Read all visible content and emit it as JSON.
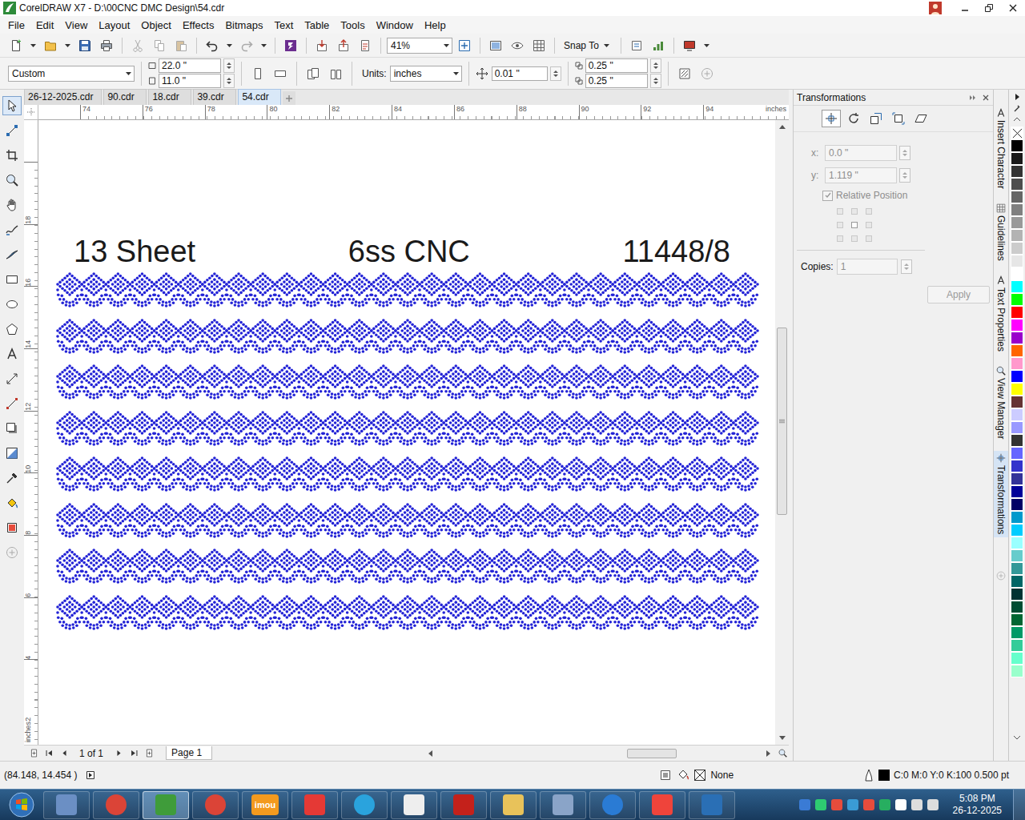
{
  "window": {
    "title": "CorelDRAW X7 - D:\\00CNC DMC Design\\54.cdr"
  },
  "menu": [
    "File",
    "Edit",
    "View",
    "Layout",
    "Object",
    "Effects",
    "Bitmaps",
    "Text",
    "Table",
    "Tools",
    "Window",
    "Help"
  ],
  "toolbar": {
    "zoom": "41%",
    "snap": "Snap To"
  },
  "property_bar": {
    "page_size": "Custom",
    "width": "22.0 \"",
    "height": "11.0 \"",
    "units_label": "Units:",
    "units": "inches",
    "nudge": "0.01 \"",
    "dup_x": "0.25 \"",
    "dup_y": "0.25 \""
  },
  "doc_tabs": [
    {
      "label": "26-12-2025.cdr",
      "selected": false
    },
    {
      "label": "90.cdr",
      "selected": false
    },
    {
      "label": "18.cdr",
      "selected": false
    },
    {
      "label": "39.cdr",
      "selected": false
    },
    {
      "label": "54.cdr",
      "selected": true
    }
  ],
  "ruler": {
    "h_ticks": [
      "74",
      "76",
      "78",
      "80",
      "82",
      "84",
      "86",
      "88",
      "90",
      "92",
      "94"
    ],
    "h_unit": "inches",
    "v_ticks": [
      "18",
      "16",
      "14",
      "12",
      "10",
      "8",
      "6",
      "4",
      "2"
    ],
    "v_unit": "inches"
  },
  "toolbox": [
    {
      "selected": true
    },
    {
      "selected": false
    },
    {
      "selected": false
    },
    {
      "selected": false
    },
    {
      "selected": false
    },
    {
      "selected": false
    },
    {
      "selected": false
    },
    {
      "selected": false
    },
    {
      "selected": false
    },
    {
      "selected": false
    },
    {
      "selected": false
    },
    {
      "selected": false
    },
    {
      "selected": false
    },
    {
      "selected": false
    },
    {
      "selected": false
    },
    {
      "selected": false
    },
    {
      "selected": false
    },
    {
      "selected": false
    },
    {
      "selected": false
    }
  ],
  "canvas": {
    "texts": [
      "13 Sheet",
      "6ss CNC",
      "11448/8"
    ],
    "rows": [
      {
        "motifs": 29
      },
      {
        "motifs": 29
      },
      {
        "motifs": 29
      },
      {
        "motifs": 29
      },
      {
        "motifs": 29
      },
      {
        "motifs": 29
      },
      {
        "motifs": 29
      },
      {
        "motifs": 29
      }
    ]
  },
  "page_nav": {
    "counter": "1 of 1",
    "page_tab": "Page 1"
  },
  "docker": {
    "title": "Transformations",
    "tools": [
      {
        "selected": true
      },
      {
        "selected": false
      },
      {
        "selected": false
      },
      {
        "selected": false
      },
      {
        "selected": false
      }
    ],
    "fields": [
      {
        "label": "x:",
        "value": "0.0 \"",
        "disabled": true
      },
      {
        "label": "y:",
        "value": "1.119 \"",
        "disabled": true
      }
    ],
    "relative": {
      "label": "Relative Position",
      "checked": true,
      "disabled": true
    },
    "anchors": [
      {
        "selected": false
      },
      {
        "selected": false
      },
      {
        "selected": false
      },
      {
        "selected": false
      },
      {
        "selected": true
      },
      {
        "selected": false
      },
      {
        "selected": false
      },
      {
        "selected": false
      },
      {
        "selected": false
      }
    ],
    "copies": {
      "label": "Copies:",
      "value": "1",
      "disabled": true
    },
    "apply": {
      "label": "Apply",
      "disabled": true
    }
  },
  "docker_tabs": [
    {
      "label": "Insert Character",
      "selected": false
    },
    {
      "label": "Guidelines",
      "selected": false
    },
    {
      "label": "Text Properties",
      "selected": false
    },
    {
      "label": "View Manager",
      "selected": false
    },
    {
      "label": "Transformations",
      "selected": true
    }
  ],
  "palette": [
    {
      "kind": "none",
      "color": "#ffffff"
    },
    {
      "kind": "swatch",
      "color": "#000000"
    },
    {
      "kind": "swatch",
      "color": "#1a1a1a"
    },
    {
      "kind": "swatch",
      "color": "#333333"
    },
    {
      "kind": "swatch",
      "color": "#4d4d4d"
    },
    {
      "kind": "swatch",
      "color": "#666666"
    },
    {
      "kind": "swatch",
      "color": "#808080"
    },
    {
      "kind": "swatch",
      "color": "#999999"
    },
    {
      "kind": "swatch",
      "color": "#b3b3b3"
    },
    {
      "kind": "swatch",
      "color": "#cccccc"
    },
    {
      "kind": "swatch",
      "color": "#e6e6e6"
    },
    {
      "kind": "swatch",
      "color": "#ffffff"
    },
    {
      "kind": "swatch",
      "color": "#00ffff"
    },
    {
      "kind": "swatch",
      "color": "#00ff00"
    },
    {
      "kind": "swatch",
      "color": "#ff0000"
    },
    {
      "kind": "swatch",
      "color": "#ff00ff"
    },
    {
      "kind": "swatch",
      "color": "#9900cc"
    },
    {
      "kind": "swatch",
      "color": "#ff6600"
    },
    {
      "kind": "swatch",
      "color": "#ff99cc"
    },
    {
      "kind": "swatch",
      "color": "#0000ff"
    },
    {
      "kind": "swatch",
      "color": "#ffff00"
    },
    {
      "kind": "swatch",
      "color": "#663333"
    },
    {
      "kind": "swatch",
      "color": "#ccccff"
    },
    {
      "kind": "swatch",
      "color": "#9999ff"
    },
    {
      "kind": "swatch",
      "color": "#333333"
    },
    {
      "kind": "swatch",
      "color": "#6666ff"
    },
    {
      "kind": "swatch",
      "color": "#3333cc"
    },
    {
      "kind": "swatch",
      "color": "#333399"
    },
    {
      "kind": "swatch",
      "color": "#000099"
    },
    {
      "kind": "swatch",
      "color": "#000066"
    },
    {
      "kind": "swatch",
      "color": "#0099cc"
    },
    {
      "kind": "swatch",
      "color": "#00ccff"
    },
    {
      "kind": "swatch",
      "color": "#99ffff"
    },
    {
      "kind": "swatch",
      "color": "#66cccc"
    },
    {
      "kind": "swatch",
      "color": "#339999"
    },
    {
      "kind": "swatch",
      "color": "#006666"
    },
    {
      "kind": "swatch",
      "color": "#003333"
    },
    {
      "kind": "swatch",
      "color": "#004d33"
    },
    {
      "kind": "swatch",
      "color": "#006633"
    },
    {
      "kind": "swatch",
      "color": "#009966"
    },
    {
      "kind": "swatch",
      "color": "#33cc99"
    },
    {
      "kind": "swatch",
      "color": "#66ffcc"
    },
    {
      "kind": "swatch",
      "color": "#99ffcc"
    }
  ],
  "status": {
    "coords": "(84.148, 14.454 )",
    "fill": {
      "label": "None"
    },
    "outline": {
      "color": "#000000",
      "label": "C:0 M:0 Y:0 K:100 0.500 pt"
    }
  },
  "taskbar": {
    "apps": [
      {
        "kind": "square",
        "color": "#6b8fc4",
        "selected": false
      },
      {
        "kind": "round",
        "color": "#db4437",
        "selected": false
      },
      {
        "kind": "square",
        "color": "#3f9c3a",
        "selected": true
      },
      {
        "kind": "round",
        "color": "#db4437",
        "selected": false
      },
      {
        "kind": "square",
        "color": "#f39a1e",
        "selected": false,
        "label": "imou"
      },
      {
        "kind": "square",
        "color": "#e53935",
        "selected": false
      },
      {
        "kind": "round",
        "color": "#2aa3dd",
        "selected": false
      },
      {
        "kind": "square",
        "color": "#eeeeee",
        "selected": false
      },
      {
        "kind": "square",
        "color": "#c4211b",
        "selected": false
      },
      {
        "kind": "square",
        "color": "#e8c25a",
        "selected": false
      },
      {
        "kind": "square",
        "color": "#8aa4c8",
        "selected": false
      },
      {
        "kind": "round",
        "color": "#2a7bd4",
        "selected": false
      },
      {
        "kind": "square",
        "color": "#ef443b",
        "selected": false
      },
      {
        "kind": "square",
        "color": "#2a6fb5",
        "selected": false
      }
    ],
    "tray": [
      {
        "color": "#3a7bd5"
      },
      {
        "color": "#2ecc71"
      },
      {
        "color": "#e74c3c"
      },
      {
        "color": "#3a9bd5"
      },
      {
        "color": "#e74c3c"
      },
      {
        "color": "#27ae60"
      },
      {
        "color": "#ffffff"
      },
      {
        "color": "#dddddd"
      },
      {
        "color": "#dddddd"
      }
    ],
    "time": "5:08 PM",
    "date": "26-12-2025"
  }
}
